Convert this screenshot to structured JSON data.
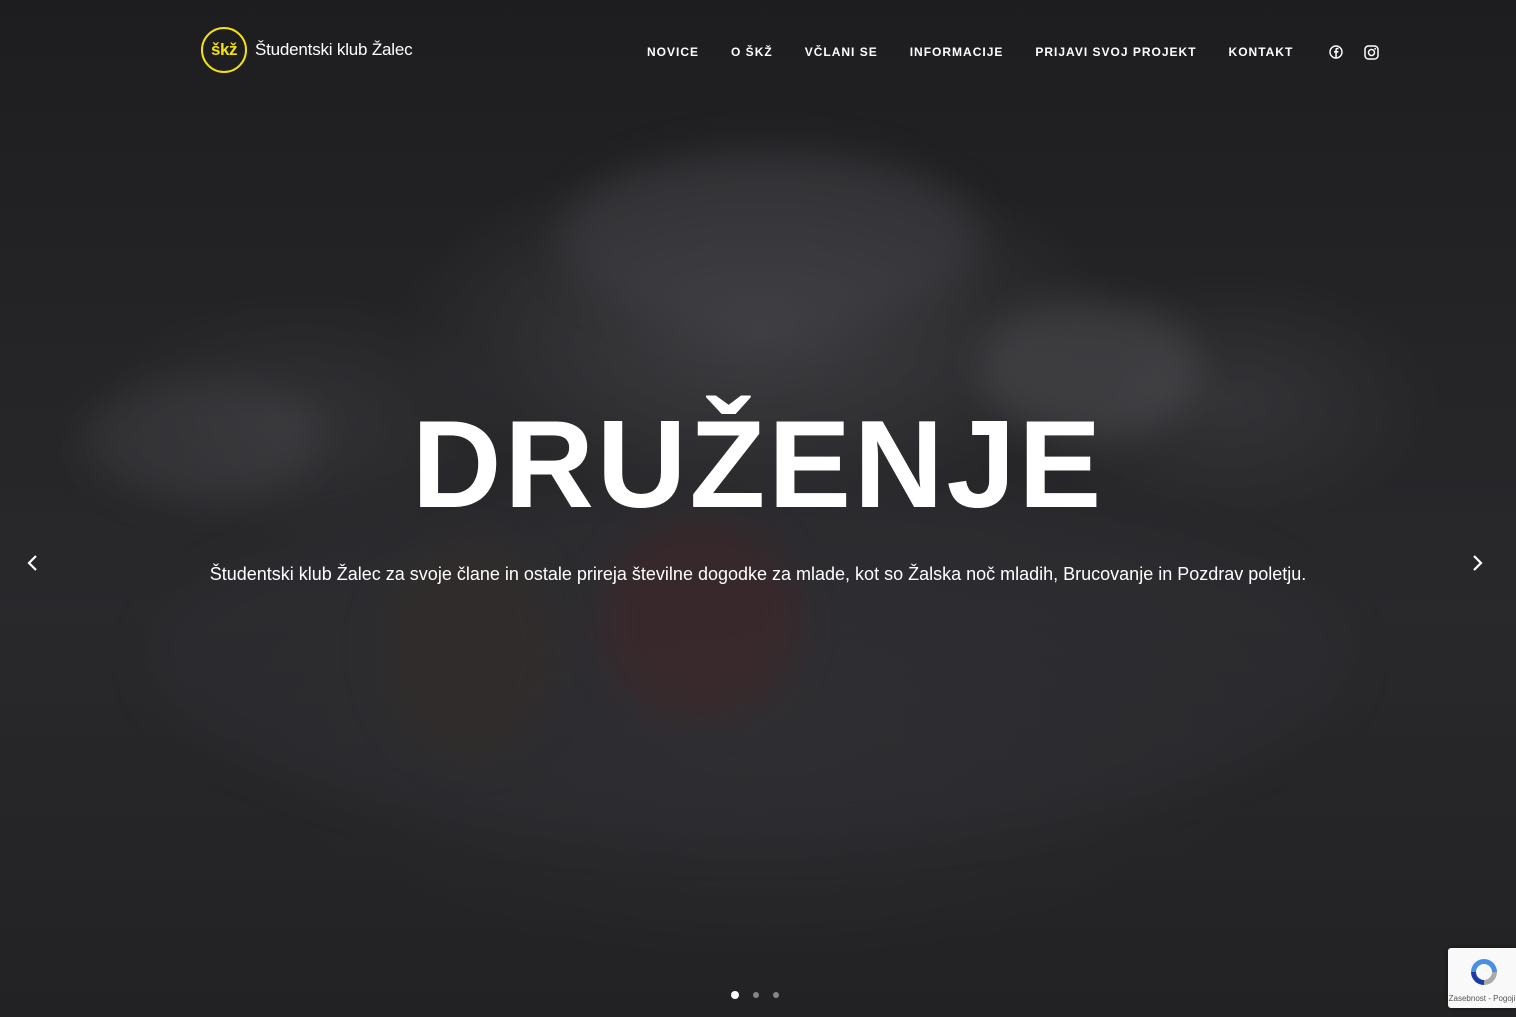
{
  "brand": {
    "logo_mark": "škž",
    "name": "Študentski klub Žalec",
    "accent_color": "#f3e015"
  },
  "nav": {
    "items": [
      {
        "label": "NOVICE"
      },
      {
        "label": "O ŠKŽ"
      },
      {
        "label": "VČLANI SE"
      },
      {
        "label": "INFORMACIJE"
      },
      {
        "label": "PRIJAVI SVOJ PROJEKT"
      },
      {
        "label": "KONTAKT"
      }
    ],
    "social_icons": [
      "facebook-icon",
      "instagram-icon"
    ]
  },
  "hero": {
    "title": "DRUŽENJE",
    "subtitle": "Študentski klub Žalec za svoje člane in ostale prireja številne dogodke za mlade, kot so Žalska noč mladih, Brucovanje in Pozdrav poletju.",
    "slides_total": 3,
    "active_slide": 1
  },
  "recaptcha": {
    "text": "Zasebnost - Pogoji"
  }
}
